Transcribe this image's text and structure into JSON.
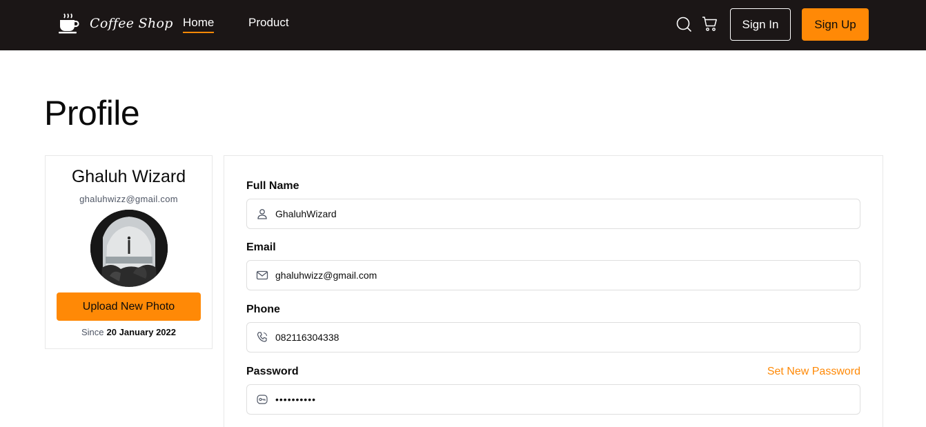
{
  "nav": {
    "logo_text": "Coffee Shop",
    "links": [
      "Home",
      "Product"
    ],
    "sign_in": "Sign In",
    "sign_up": "Sign Up",
    "active_link": "Home"
  },
  "page": {
    "title": "Profile"
  },
  "profile": {
    "name": "Ghaluh Wizard",
    "email": "ghaluhwizz@gmail.com",
    "upload_label": "Upload New Photo",
    "since_label": "Since",
    "since_date": "20 January 2022"
  },
  "form": {
    "full_name": {
      "label": "Full Name",
      "value": "GhaluhWizard",
      "icon": "user-icon"
    },
    "email": {
      "label": "Email",
      "value": "ghaluhwizz@gmail.com",
      "icon": "mail-icon"
    },
    "phone": {
      "label": "Phone",
      "value": "082116304338",
      "icon": "phone-icon"
    },
    "password": {
      "label": "Password",
      "value": "••••••••••",
      "icon": "key-icon",
      "set_new_label": "Set New Password"
    }
  },
  "colors": {
    "navbar_bg": "#1b1616",
    "accent": "#ff8906",
    "text_dark": "#0b0b0b",
    "text_muted": "#4f5665",
    "border": "#dedede"
  }
}
